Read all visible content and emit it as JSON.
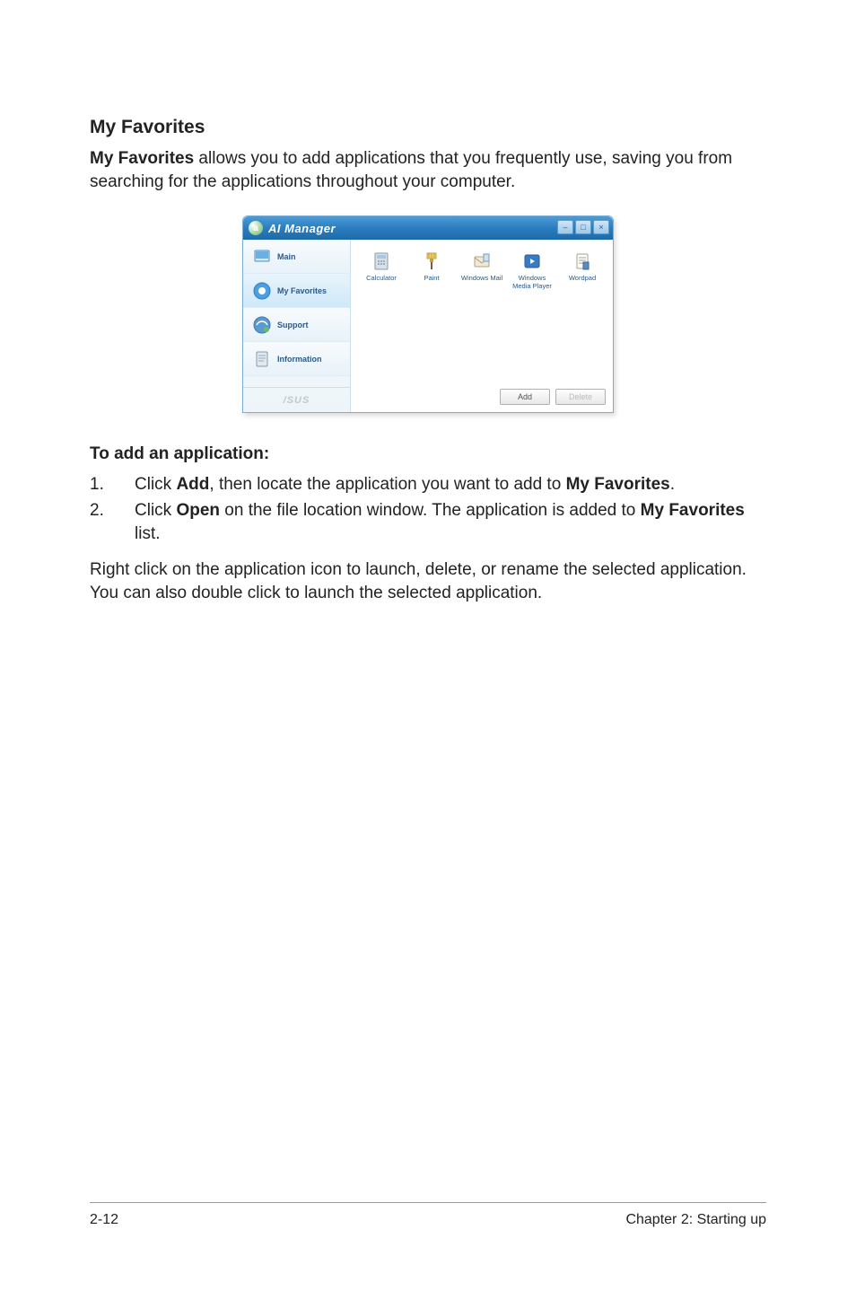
{
  "heading": "My Favorites",
  "intro": {
    "bold": "My Favorites",
    "rest": " allows you to add applications that you frequently use, saving you from searching for the applications throughout your computer."
  },
  "window": {
    "title": "AI Manager",
    "logo_letter": "a",
    "controls": {
      "minimize": "–",
      "maximize": "□",
      "close": "×"
    },
    "sidebar": {
      "items": [
        {
          "label": "Main"
        },
        {
          "label": "My Favorites"
        },
        {
          "label": "Support"
        },
        {
          "label": "Information"
        }
      ],
      "footer_brand": "/SUS"
    },
    "apps": [
      {
        "label": "Calculator"
      },
      {
        "label": "Paint"
      },
      {
        "label": "Windows Mail"
      },
      {
        "label": "Windows Media Player"
      },
      {
        "label": "Wordpad"
      }
    ],
    "buttons": {
      "add": "Add",
      "delete": "Delete"
    }
  },
  "sub_heading": "To add an application:",
  "list": [
    {
      "num": "1.",
      "prefix": "Click ",
      "bold1": "Add",
      "mid": ", then locate the application you want to add to ",
      "bold2": "My Favorites",
      "suffix": "."
    },
    {
      "num": "2.",
      "prefix": "Click ",
      "bold1": "Open",
      "mid": " on the file location window. The application is added to ",
      "bold2": "My Favorites",
      "suffix": " list."
    }
  ],
  "para": "Right click on the application icon to launch, delete, or rename the selected application. You can also double click to launch the selected application.",
  "footer": {
    "left": "2-12",
    "right": "Chapter 2: Starting up"
  }
}
